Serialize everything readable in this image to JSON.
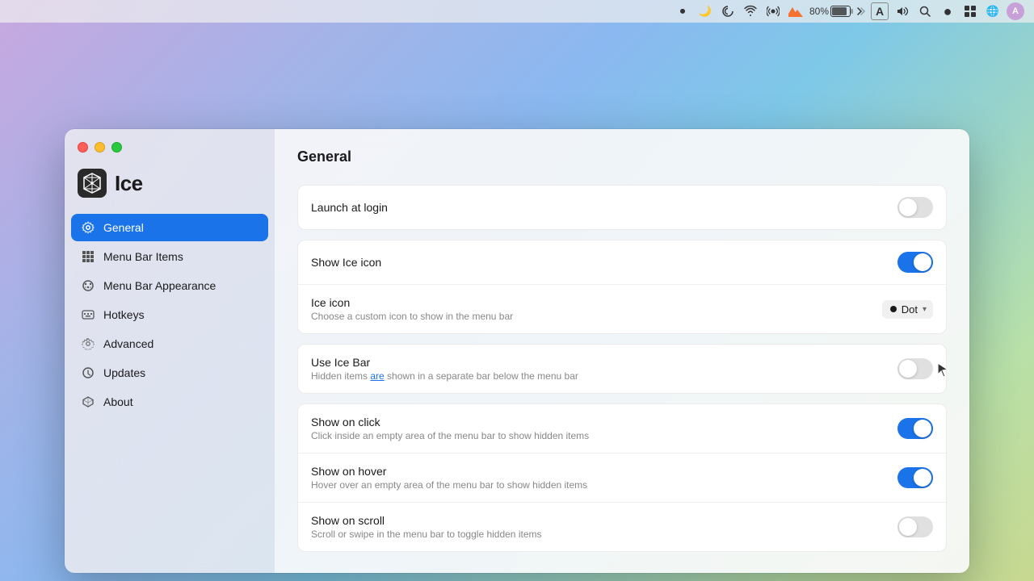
{
  "menubar": {
    "battery_percent": "80%",
    "icons": [
      {
        "name": "record-icon",
        "symbol": "⏺"
      },
      {
        "name": "moon-icon",
        "symbol": "🌙"
      },
      {
        "name": "spiral-icon",
        "symbol": "◉"
      },
      {
        "name": "wifi-icon",
        "symbol": "📶"
      },
      {
        "name": "airdrop-icon",
        "symbol": "📡"
      },
      {
        "name": "creative-cloud-icon",
        "symbol": "☁"
      },
      {
        "name": "font-icon",
        "symbol": "A"
      },
      {
        "name": "volume-icon",
        "symbol": "🔊"
      },
      {
        "name": "search-icon",
        "symbol": "🔍"
      },
      {
        "name": "dot-icon",
        "symbol": "●"
      },
      {
        "name": "layout-icon",
        "symbol": "⊞"
      },
      {
        "name": "world-icon",
        "symbol": "🌐"
      },
      {
        "name": "user-icon",
        "symbol": "👤"
      }
    ]
  },
  "app": {
    "name": "Ice",
    "logo_alt": "Ice app logo"
  },
  "sidebar": {
    "items": [
      {
        "id": "general",
        "label": "General",
        "icon": "gear",
        "active": true
      },
      {
        "id": "menu-bar-items",
        "label": "Menu Bar Items",
        "icon": "grid",
        "active": false
      },
      {
        "id": "menu-bar-appearance",
        "label": "Menu Bar Appearance",
        "icon": "palette",
        "active": false
      },
      {
        "id": "hotkeys",
        "label": "Hotkeys",
        "icon": "keyboard",
        "active": false
      },
      {
        "id": "advanced",
        "label": "Advanced",
        "icon": "gear-advanced",
        "active": false
      },
      {
        "id": "updates",
        "label": "Updates",
        "icon": "refresh",
        "active": false
      },
      {
        "id": "about",
        "label": "About",
        "icon": "cube",
        "active": false
      }
    ]
  },
  "main": {
    "title": "General",
    "settings": [
      {
        "section": "login",
        "rows": [
          {
            "id": "launch-at-login",
            "label": "Launch at login",
            "sublabel": "",
            "type": "toggle",
            "value": false
          }
        ]
      },
      {
        "section": "icon",
        "rows": [
          {
            "id": "show-ice-icon",
            "label": "Show Ice icon",
            "sublabel": "",
            "type": "toggle",
            "value": true
          },
          {
            "id": "ice-icon",
            "label": "Ice icon",
            "sublabel": "Choose a custom icon to show in the menu bar",
            "type": "dropdown",
            "value": "Dot",
            "dot": true
          }
        ]
      },
      {
        "section": "ice-bar",
        "rows": [
          {
            "id": "use-ice-bar",
            "label": "Use Ice Bar",
            "sublabel": "Hidden items are shown in a separate bar below the menu bar",
            "type": "toggle",
            "value": false,
            "cursor_hover": true
          }
        ]
      },
      {
        "section": "show-options",
        "rows": [
          {
            "id": "show-on-click",
            "label": "Show on click",
            "sublabel": "Click inside an empty area of the menu bar to show hidden items",
            "type": "toggle",
            "value": true
          },
          {
            "id": "show-on-hover",
            "label": "Show on hover",
            "sublabel": "Hover over an empty area of the menu bar to show hidden items",
            "type": "toggle",
            "value": true
          },
          {
            "id": "show-on-scroll",
            "label": "Show on scroll",
            "sublabel": "Scroll or swipe in the menu bar to toggle hidden items",
            "type": "toggle",
            "value": false
          }
        ]
      }
    ]
  }
}
